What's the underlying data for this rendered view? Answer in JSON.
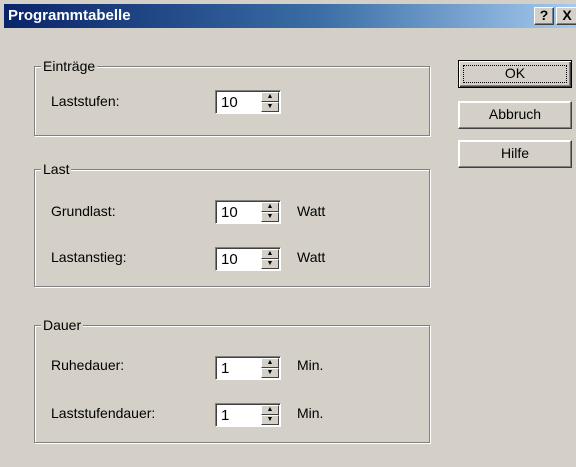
{
  "window": {
    "title": "Programmtabelle",
    "help_button": "?",
    "close_button": "X"
  },
  "groups": {
    "eintraege": {
      "title": "Einträge",
      "fields": {
        "laststufen": {
          "label": "Laststufen:",
          "value": "10",
          "unit": ""
        }
      }
    },
    "last": {
      "title": "Last",
      "fields": {
        "grundlast": {
          "label": "Grundlast:",
          "value": "10",
          "unit": "Watt"
        },
        "lastanstieg": {
          "label": "Lastanstieg:",
          "value": "10",
          "unit": "Watt"
        }
      }
    },
    "dauer": {
      "title": "Dauer",
      "fields": {
        "ruhedauer": {
          "label": "Ruhedauer:",
          "value": "1",
          "unit": "Min."
        },
        "laststufendauer": {
          "label": "Laststufendauer:",
          "value": "1",
          "unit": "Min."
        }
      }
    }
  },
  "buttons": {
    "ok": "OK",
    "cancel": "Abbruch",
    "help": "Hilfe"
  },
  "icons": {
    "spin_up": "spin-up-arrow-icon",
    "spin_down": "spin-down-arrow-icon"
  },
  "colors": {
    "dialog_face": "#d4d0c8",
    "title_start": "#0a246a",
    "title_end": "#a6caf0",
    "title_text": "#ffffff"
  }
}
